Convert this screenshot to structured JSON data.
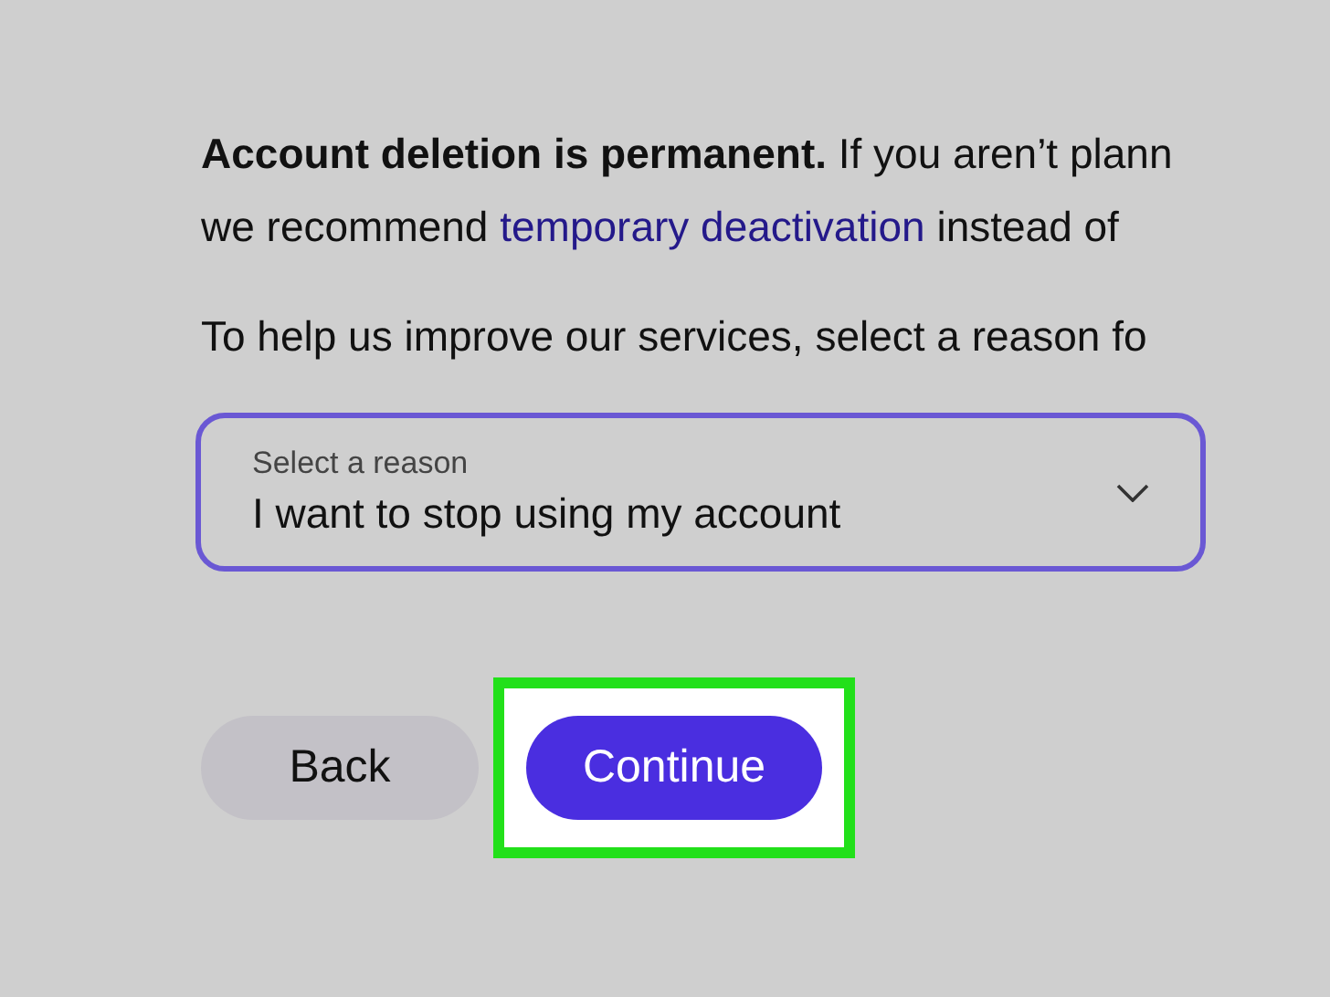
{
  "notice": {
    "line_1": "**Account deletion is permanent.** If you aren’t plann",
    "line_2": {
      "before": "we recommend",
      "link": "temporary deactivation",
      "after": "instead of"
    }
  },
  "prompt": "To help us improve our services, select a reason fo",
  "reason_select": {
    "label": "Select a reason",
    "value": "I want to stop using my account"
  },
  "buttons": [
    {
      "label": "Back",
      "kind": "secondary",
      "highlighted": false
    },
    {
      "label": "Continue",
      "kind": "primary",
      "highlighted": true
    }
  ]
}
